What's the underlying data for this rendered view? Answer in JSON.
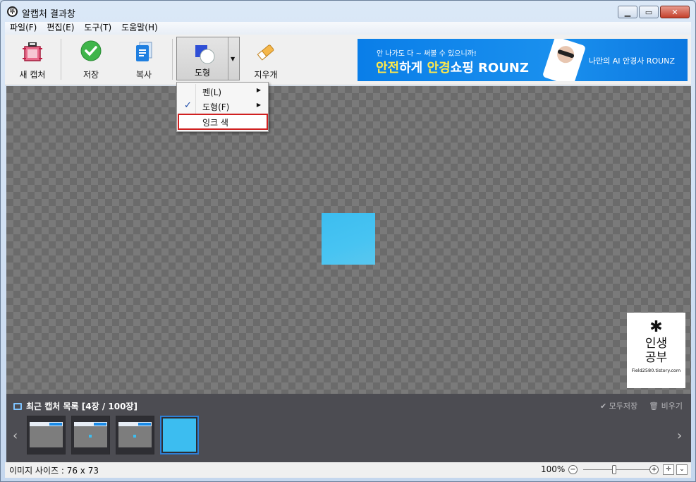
{
  "window": {
    "title": "알캡처 결과창",
    "app_icon_glyph": "뚜"
  },
  "menu": [
    "파일(F)",
    "편집(E)",
    "도구(T)",
    "도움말(H)"
  ],
  "toolbar": {
    "new_capture": "새 캡처",
    "save": "저장",
    "copy": "복사",
    "shape": "도형",
    "eraser": "지우개"
  },
  "banner": {
    "line1": "안 나가도 다 ~ 써볼 수 있으니까!",
    "line2_a": "안전",
    "line2_b": "하게 ",
    "line2_c": "안경",
    "line2_d": "쇼핑 ROUNZ",
    "right": "나만의 AI 안경사 ROUNZ"
  },
  "dropdown": {
    "items": [
      {
        "label": "펜(L)",
        "has_submenu": true,
        "checked": false
      },
      {
        "label": "도형(F)",
        "has_submenu": true,
        "checked": true
      },
      {
        "label": "잉크 색",
        "has_submenu": false,
        "checked": false
      }
    ],
    "check_glyph": "✓",
    "submenu_glyph": "▶"
  },
  "watermark": {
    "icon": "✱",
    "title_line1": "인생",
    "title_line2": "공부",
    "url": "Field2580.tistory.com"
  },
  "recent": {
    "title": "최근 캡처 목록 [4장 / 100장]",
    "save_all": "✔ 모두저장",
    "clear": "🗑 비우기",
    "count": 4
  },
  "status": {
    "image_size": "이미지 사이즈 : 76 x 73",
    "zoom": "100%",
    "zoom_fraction": 0.5
  },
  "colors": {
    "accent": "#2d7fd6",
    "captured_fill": "#3cbdf0",
    "banner_bg": "#0a7ee8",
    "highlight_border": "#d02020"
  }
}
